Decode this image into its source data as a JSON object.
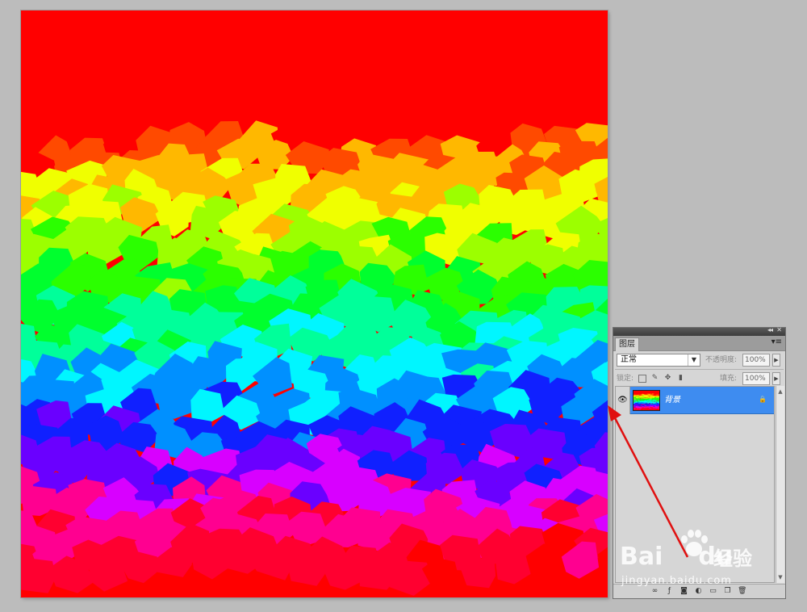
{
  "canvas": {
    "background": "#ff0000",
    "bands": [
      "#ff0000",
      "#ff4a00",
      "#ffb800",
      "#f0ff00",
      "#9cff00",
      "#2bff00",
      "#00ff2e",
      "#00ff9a",
      "#00f6ff",
      "#0090ff",
      "#1020ff",
      "#6a00ff",
      "#d800ff",
      "#ff0090",
      "#ff0030",
      "#ff0000"
    ]
  },
  "layers_panel": {
    "collapse_label": "◂◂",
    "close_label": "✕",
    "tab_label": "图层",
    "tab_menu_label": "▾≡",
    "blend_mode": "正常",
    "opacity_label": "不透明度:",
    "opacity_value": "100%",
    "lock_label": "锁定:",
    "fill_label": "填充:",
    "fill_value": "100%",
    "layers": [
      {
        "name": "背景",
        "visible": true,
        "locked": true,
        "selected": true
      }
    ],
    "accent": "#3e8cf0"
  },
  "watermark": {
    "logo": "Bai",
    "logo_suffix": "du",
    "brand": "经验",
    "url": "jingyan.baidu.com"
  },
  "annotation_color": "#e01010"
}
